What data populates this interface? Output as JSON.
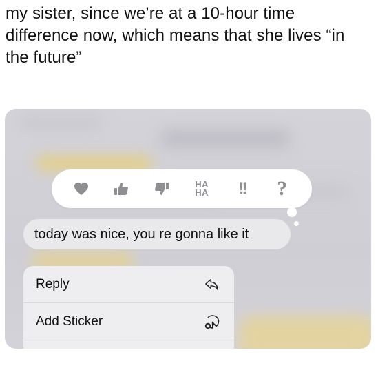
{
  "caption": "my sister, since we’re at a 10-hour time difference now, which means that she lives “in the future”",
  "tapback": {
    "reactions": [
      "heart-icon",
      "thumbs-up-icon",
      "thumbs-down-icon",
      "haha-icon",
      "exclamation-icon",
      "question-icon"
    ],
    "haha_top": "HA",
    "haha_bottom": "HA",
    "exclaim": "!!",
    "question": "?"
  },
  "message": {
    "text": "today was nice, you re gonna like it"
  },
  "menu": {
    "items": [
      {
        "label": "Reply",
        "icon": "reply-arrow-icon"
      },
      {
        "label": "Add Sticker",
        "icon": "add-sticker-icon"
      }
    ]
  },
  "colors": {
    "reaction_gray": "#8e8e93",
    "bubble": "#e9e9eb",
    "backdrop": "#d2d1d7"
  }
}
